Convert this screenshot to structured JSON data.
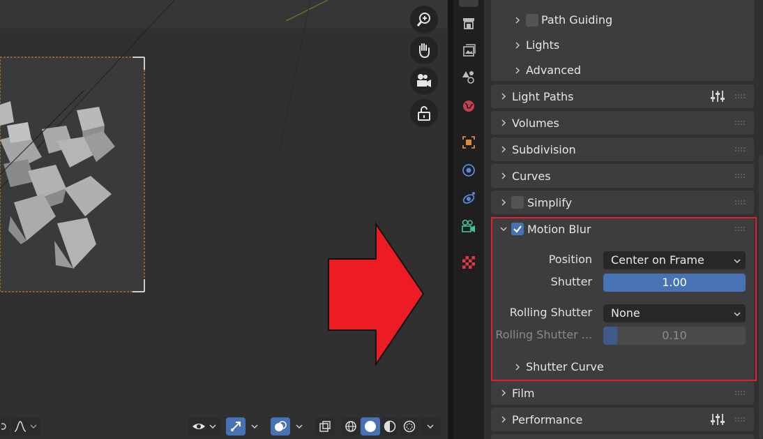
{
  "properties": {
    "sub_items": [
      {
        "label": "Path Guiding",
        "checkbox": false
      },
      {
        "label": "Lights"
      },
      {
        "label": "Advanced"
      }
    ],
    "panels": [
      {
        "label": "Light Paths"
      },
      {
        "label": "Volumes"
      },
      {
        "label": "Subdivision"
      },
      {
        "label": "Curves"
      },
      {
        "label": "Simplify",
        "checkbox": false
      },
      {
        "label": "Film"
      },
      {
        "label": "Performance"
      }
    ],
    "motion_blur": {
      "label": "Motion Blur",
      "enabled": true,
      "position_label": "Position",
      "position_value": "Center on Frame",
      "shutter_label": "Shutter",
      "shutter_value": "1.00",
      "rolling_label": "Rolling Shutter",
      "rolling_value": "None",
      "rolling_duration_label": "Rolling Shutter ...",
      "rolling_duration_value": "0.10",
      "rolling_duration_fraction": 0.1,
      "shutter_curve_label": "Shutter Curve"
    }
  },
  "colors": {
    "accent": "#4772b3",
    "highlight": "#e21f2a",
    "arrow": "#ed1c24",
    "panel": "#3d3d3d",
    "background": "#303030"
  },
  "icons": {
    "viewport_nav": [
      "zoom-icon",
      "hand-pan-icon",
      "camera-icon",
      "lock-icon"
    ],
    "tabs": [
      "output-icon",
      "view-layer-icon",
      "scene-icon",
      "world-icon",
      "object-icon",
      "modifier-icon",
      "particles-icon",
      "physics-icon",
      "texture-icon"
    ]
  }
}
